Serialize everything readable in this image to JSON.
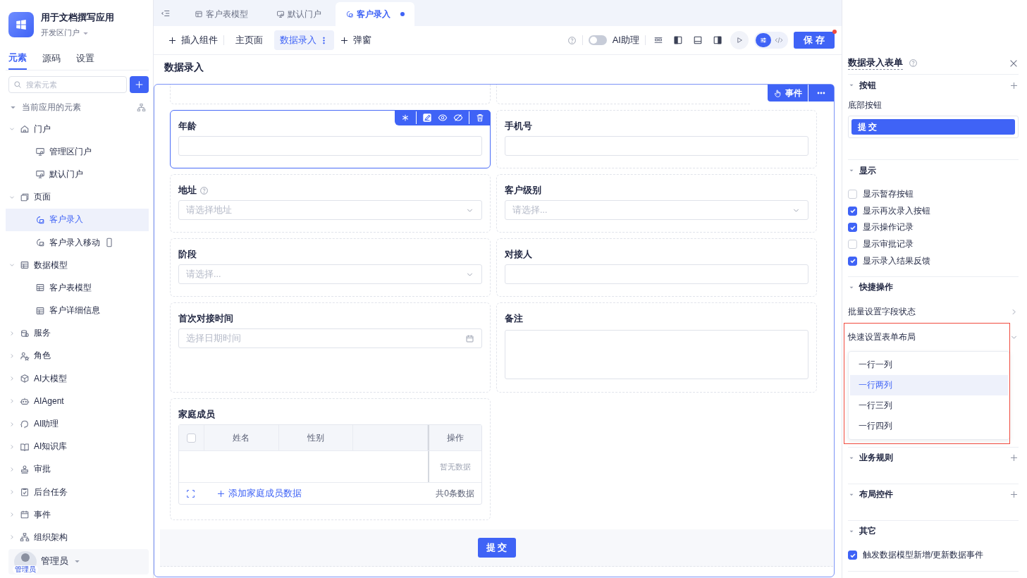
{
  "app": {
    "name": "用于文档撰写应用",
    "portal": "开发区门户"
  },
  "sidebar": {
    "tabs": [
      {
        "label": "元素",
        "selected": true
      },
      {
        "label": "源码",
        "selected": false
      },
      {
        "label": "设置",
        "selected": false
      }
    ],
    "search": {
      "placeholder": "搜索元素"
    },
    "section": "当前应用的元素",
    "tree": [
      {
        "label": "门户",
        "expanded": true,
        "selected": false,
        "children": [
          {
            "label": "管理区门户",
            "selected": false
          },
          {
            "label": "默认门户",
            "selected": false
          }
        ]
      },
      {
        "label": "页面",
        "expanded": true,
        "selected": false,
        "children": [
          {
            "label": "客户录入",
            "selected": true
          },
          {
            "label": "客户录入移动",
            "selected": false,
            "mobile": true
          }
        ]
      },
      {
        "label": "数据模型",
        "expanded": true,
        "selected": false,
        "children": [
          {
            "label": "客户表模型",
            "selected": false
          },
          {
            "label": "客户详细信息",
            "selected": false
          }
        ]
      },
      {
        "label": "服务",
        "expanded": false,
        "selected": false
      },
      {
        "label": "角色",
        "expanded": false,
        "selected": false
      },
      {
        "label": "AI大模型",
        "expanded": false,
        "selected": false
      },
      {
        "label": "AIAgent",
        "expanded": false,
        "selected": false
      },
      {
        "label": "AI助理",
        "expanded": false,
        "selected": false
      },
      {
        "label": "AI知识库",
        "expanded": false,
        "selected": false
      },
      {
        "label": "审批",
        "expanded": false,
        "selected": false
      },
      {
        "label": "后台任务",
        "expanded": false,
        "selected": false
      },
      {
        "label": "事件",
        "expanded": false,
        "selected": false
      },
      {
        "label": "组织架构",
        "expanded": false,
        "selected": false
      }
    ],
    "user": {
      "name": "管理员",
      "avatar_label": "管理员"
    }
  },
  "editor_tabs": [
    {
      "label": "客户表模型",
      "selected": false,
      "modified": false
    },
    {
      "label": "默认门户",
      "selected": false,
      "modified": false
    },
    {
      "label": "客户录入",
      "selected": true,
      "modified": true
    }
  ],
  "toolbar": {
    "insert": "插入组件",
    "pages": [
      {
        "label": "主页面",
        "selected": false
      },
      {
        "label": "数据录入",
        "selected": true
      }
    ],
    "popup": "弹窗",
    "ai_assistant": {
      "label": "AI助理",
      "on": false
    },
    "panel_modes": [
      {
        "selected": true
      },
      {
        "selected": false
      }
    ],
    "save": "保 存"
  },
  "canvas": {
    "title": "数据录入",
    "event_button": "事件",
    "fields": [
      {
        "kind": "text",
        "label": "年龄",
        "selected": true
      },
      {
        "kind": "text",
        "label": "手机号",
        "selected": false
      },
      {
        "kind": "select",
        "label": "地址",
        "help": true,
        "placeholder": "请选择地址",
        "selected": false
      },
      {
        "kind": "select",
        "label": "客户级别",
        "placeholder": "请选择...",
        "selected": false
      },
      {
        "kind": "select",
        "label": "阶段",
        "placeholder": "请选择...",
        "selected": false
      },
      {
        "kind": "text",
        "label": "对接人",
        "selected": false
      },
      {
        "kind": "date",
        "label": "首次对接时间",
        "placeholder": "选择日期时间",
        "selected": false
      },
      {
        "kind": "textarea",
        "label": "备注",
        "selected": false
      },
      {
        "kind": "table",
        "label": "家庭成员",
        "selected": false,
        "select_all_checked": false,
        "columns": [
          "姓名",
          "性别",
          "",
          "操作"
        ],
        "empty_text": "暂无数据",
        "add_label": "添加家庭成员数据",
        "total": "共0条数据"
      }
    ],
    "submit": "提 交"
  },
  "panel": {
    "title": "数据录入表单",
    "sections": [
      {
        "kind": "buttons",
        "title": "按钮",
        "addable": true,
        "label": "底部按钮",
        "buttons": [
          "提 交"
        ]
      },
      {
        "kind": "checks",
        "title": "显示",
        "addable": false,
        "items": [
          {
            "label": "显示暂存按钮",
            "checked": false
          },
          {
            "label": "显示再次录入按钮",
            "checked": true
          },
          {
            "label": "显示操作记录",
            "checked": true
          },
          {
            "label": "显示审批记录",
            "checked": false
          },
          {
            "label": "显示录入结果反馈",
            "checked": true
          }
        ]
      },
      {
        "kind": "actions",
        "title": "快捷操作",
        "addable": false,
        "items": [
          {
            "label": "批量设置字段状态",
            "expanded": false,
            "highlighted": false
          },
          {
            "label": "快速设置表单布局",
            "expanded": true,
            "highlighted": true,
            "options": [
              {
                "label": "一行一列",
                "selected": false
              },
              {
                "label": "一行两列",
                "selected": true
              },
              {
                "label": "一行三列",
                "selected": false
              },
              {
                "label": "一行四列",
                "selected": false
              }
            ]
          }
        ]
      },
      {
        "kind": "empty",
        "title": "业务规则",
        "addable": true
      },
      {
        "kind": "empty",
        "title": "布局控件",
        "addable": true
      },
      {
        "kind": "checks",
        "title": "其它",
        "addable": false,
        "items": [
          {
            "label": "触发数据模型新增/更新数据事件",
            "checked": true
          }
        ]
      }
    ]
  }
}
